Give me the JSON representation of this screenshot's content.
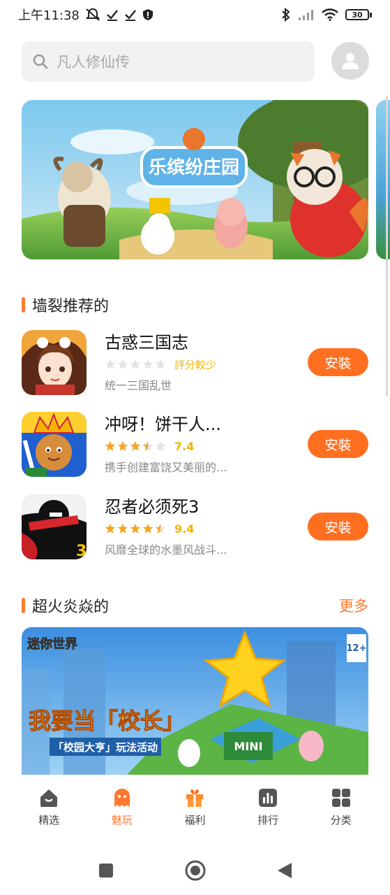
{
  "status_bar": {
    "time": "上午11:38",
    "battery": "30"
  },
  "search": {
    "placeholder": "凡人修仙传"
  },
  "section_recommended": {
    "title": "墙裂推荐的"
  },
  "apps": [
    {
      "name": "古惑三国志",
      "rating_text": "評分較少",
      "rating": 0,
      "description": "统一三国乱世",
      "button": "安裝"
    },
    {
      "name": "冲呀！饼干人...",
      "rating_text": "7.4",
      "rating": 3.5,
      "description": "携手创建富饶又美丽的...",
      "button": "安裝"
    },
    {
      "name": "忍者必须死3",
      "rating_text": "9.4",
      "rating": 4.5,
      "description": "风靡全球的水墨风战斗...",
      "button": "安裝"
    }
  ],
  "section_hot": {
    "title": "超火炎焱的",
    "more": "更多"
  },
  "banner_logo": "乐缤纷庄园",
  "promo": {
    "game_logo": "迷你世界",
    "headline": "我要当「校长」",
    "sub": "「校园大亨」玩法活动",
    "age_badge": "12+",
    "sign": "MINI"
  },
  "bottom_nav": [
    {
      "label": "精选",
      "icon": "home-icon",
      "active": false
    },
    {
      "label": "魅玩",
      "icon": "ghost-icon",
      "active": true
    },
    {
      "label": "福利",
      "icon": "gift-icon",
      "active": false
    },
    {
      "label": "排行",
      "icon": "ranking-icon",
      "active": false
    },
    {
      "label": "分类",
      "icon": "category-icon",
      "active": false
    }
  ],
  "colors": {
    "accent": "#ff7a2e",
    "button": "#ff6f1f",
    "star": "#f5a623"
  }
}
